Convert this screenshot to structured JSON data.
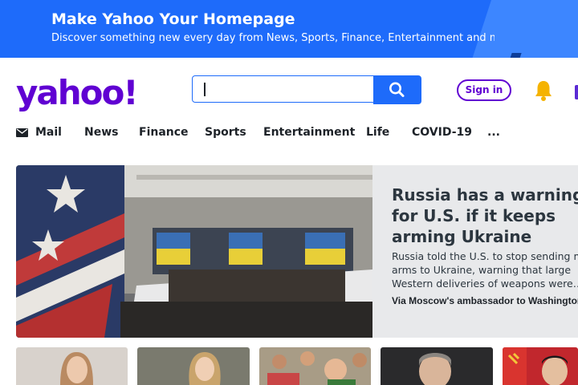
{
  "banner": {
    "title": "Make Yahoo Your Homepage",
    "subtitle": "Discover something new every day from News, Sports, Finance, Entertainment and more!"
  },
  "header": {
    "logo_text": "yahoo!",
    "search_value": "",
    "search_icon": "search-icon",
    "sign_in_label": "Sign in",
    "notifications_icon": "bell-icon"
  },
  "nav": {
    "mail_label": "Mail",
    "mail_icon": "mail-icon",
    "items": [
      "News",
      "Finance",
      "Sports",
      "Entertainment",
      "Life",
      "COVID-19",
      "..."
    ]
  },
  "hero": {
    "title": "Russia has a warning\nfor U.S. if it keeps\narming Ukraine",
    "description": "Russia told the U.S. to stop sending more\narms to Ukraine, warning that large\nWestern deliveries of weapons were…",
    "source_link": "Via Moscow's ambassador to Washington »"
  },
  "colors": {
    "brand_purple": "#6001d2",
    "accent_blue": "#1e6bfa",
    "bell_yellow": "#f5b301"
  }
}
